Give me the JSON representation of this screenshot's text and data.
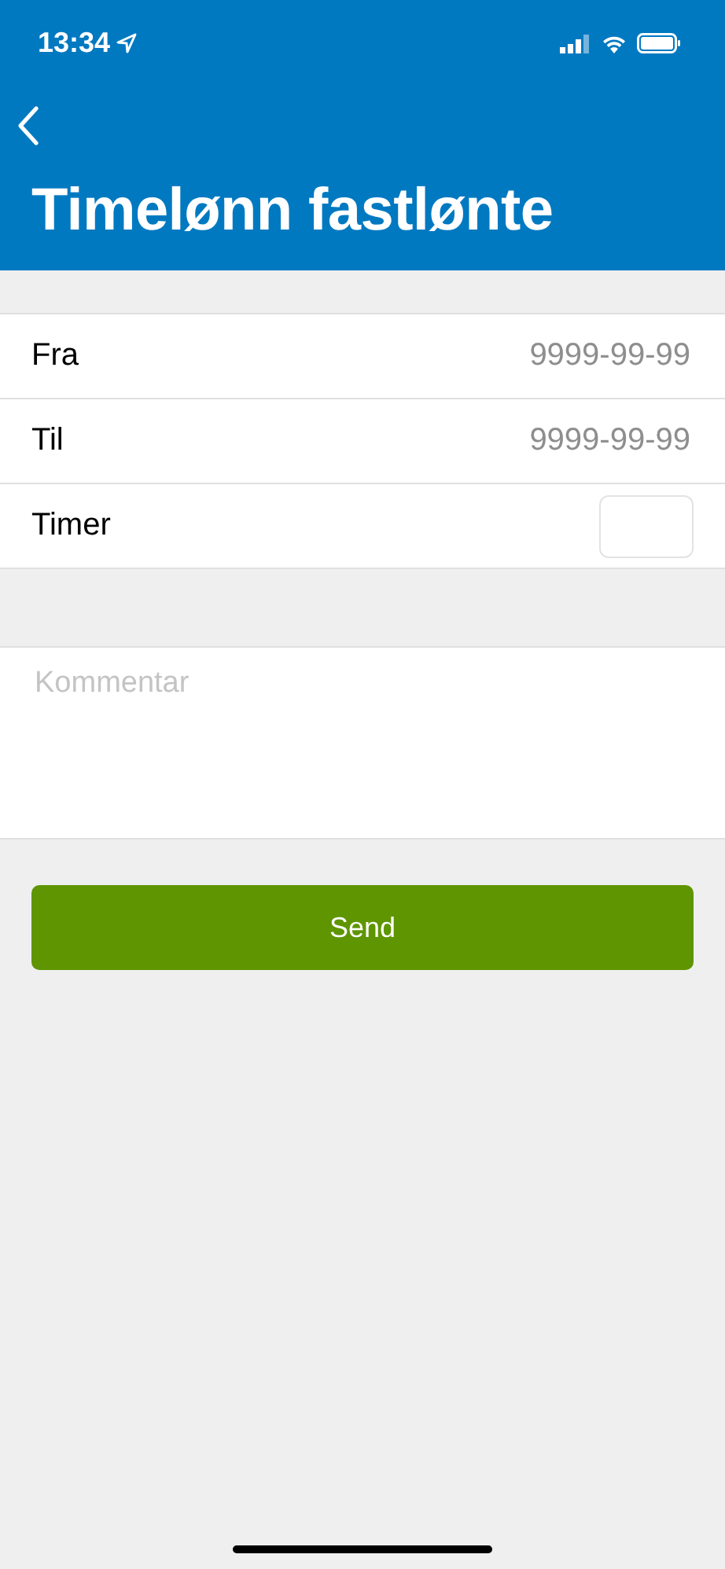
{
  "status_bar": {
    "time": "13:34"
  },
  "title": "Timelønn fastlønte",
  "fields": [
    {
      "kind": "date",
      "label": "Fra",
      "placeholder": "9999-99-99"
    },
    {
      "kind": "date",
      "label": "Til",
      "placeholder": "9999-99-99"
    },
    {
      "kind": "box",
      "label": "Timer"
    }
  ],
  "comment": {
    "placeholder": "Kommentar"
  },
  "button": "Send"
}
